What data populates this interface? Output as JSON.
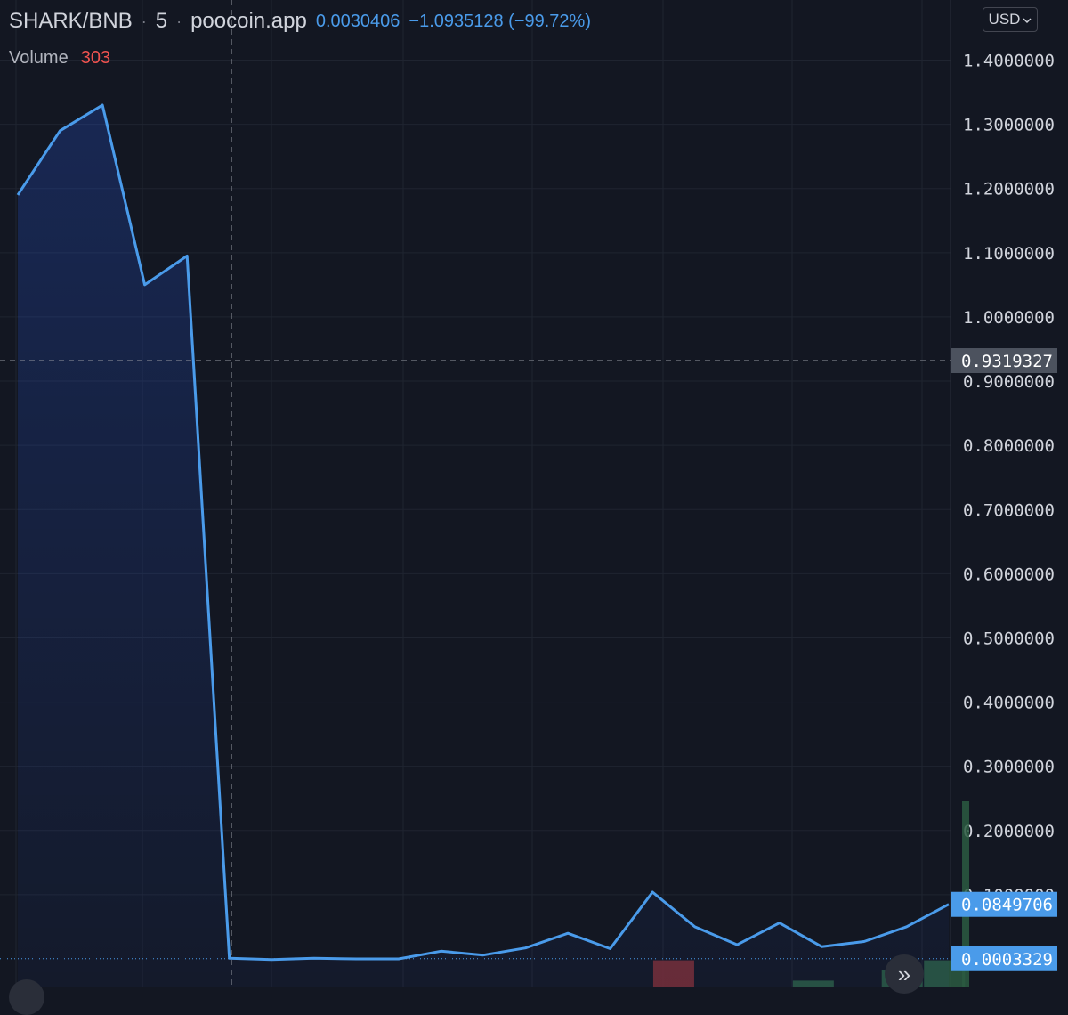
{
  "header": {
    "symbol": "SHARK/BNB",
    "separator": "·",
    "interval": "5",
    "source": "poocoin.app",
    "last_price": "0.0030406",
    "change": "−1.0935128 (−99.72%)"
  },
  "volume": {
    "label": "Volume",
    "value": "303"
  },
  "currency": {
    "label": "USD",
    "icon": "chevron-down-icon"
  },
  "scroll_button": {
    "icon": "double-chevron-right-icon",
    "glyph": "»"
  },
  "crosshair_label": "0.9319327",
  "price_labels": {
    "current": "0.0849706",
    "low": "0.0003329"
  },
  "colors": {
    "background": "#131722",
    "line": "#4a9bea",
    "grid": "#1f2430",
    "crosshair_label_bg": "#4c525e",
    "price_label_bg": "#4a9bea",
    "up_volume": "#2b5a41",
    "down_volume": "#7a2d33"
  },
  "chart_data": {
    "type": "area",
    "y_axis": {
      "min": 0,
      "max": 1.4,
      "ticks": [
        "1.4000000",
        "1.3000000",
        "1.2000000",
        "1.1000000",
        "1.0000000",
        "0.9000000",
        "0.8000000",
        "0.7000000",
        "0.6000000",
        "0.5000000",
        "0.4000000",
        "0.3000000",
        "0.2000000",
        "0.1000000"
      ]
    },
    "series": [
      {
        "values": [
          1.19,
          1.29,
          1.33,
          1.05,
          1.095,
          0.001,
          -0.001,
          0.001,
          0.0,
          0.0,
          0.012,
          0.006,
          0.017,
          0.04,
          0.016,
          0.104,
          0.05,
          0.022,
          0.056,
          0.019,
          0.027,
          0.05,
          0.085
        ]
      }
    ],
    "volume_bars": [
      {
        "index": 15.5,
        "value": 0.08,
        "direction": "down"
      },
      {
        "index": 18.8,
        "value": 0.02,
        "direction": "up"
      },
      {
        "index": 20.9,
        "value": 0.05,
        "direction": "up"
      },
      {
        "index": 21.9,
        "value": 0.08,
        "direction": "up"
      },
      {
        "index": 22.4,
        "value": 0.55,
        "direction": "up"
      }
    ],
    "grid": true
  }
}
